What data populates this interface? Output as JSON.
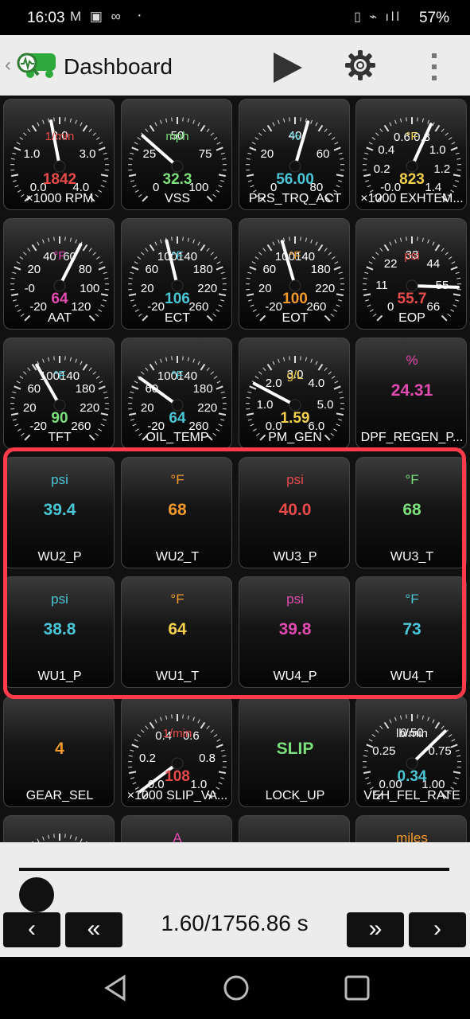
{
  "status": {
    "time": "16:03",
    "left_icons": "M ▣ ∞",
    "more": "·",
    "right_icons": "▯ ⌁ ıll",
    "battery": "57%"
  },
  "appbar": {
    "title": "Dashboard"
  },
  "tiles": [
    {
      "name": "×1000 RPM",
      "unit": "1/min",
      "value": "1842",
      "ticks": [
        "0.0",
        "1.0",
        "2.0",
        "3.0",
        "4.0"
      ],
      "colors": {
        "unit": "#e94b4b",
        "value": "#e94b4b"
      },
      "needle": 0.46
    },
    {
      "name": "VSS",
      "unit": "mph",
      "value": "32.3",
      "ticks": [
        "0",
        "25",
        "50",
        "75",
        "100"
      ],
      "colors": {
        "unit": "#7be07b",
        "value": "#7be07b"
      },
      "needle": 0.32
    },
    {
      "name": "PRS_TRQ_ACT",
      "unit": "%",
      "value": "56.00",
      "ticks": [
        "0",
        "20",
        "40",
        "60",
        "80"
      ],
      "colors": {
        "unit": "#4bc6d6",
        "value": "#4bc6d6"
      },
      "needle": 0.56
    },
    {
      "name": "×1000 EXHTEM...",
      "unit": "°F",
      "value": "823",
      "ticks": [
        "-0.0",
        "0.2",
        "0.4",
        "0.6",
        "0.8",
        "1.0",
        "1.2",
        "1.4"
      ],
      "colors": {
        "unit": "#f2d04b",
        "value": "#f2d04b"
      },
      "needle": 0.59
    },
    {
      "name": "AAT",
      "unit": "°F",
      "value": "64",
      "ticks": [
        "-20",
        "-0",
        "20",
        "40",
        "60",
        "80",
        "100",
        "120"
      ],
      "colors": {
        "unit": "#e14bb0",
        "value": "#e14bb0"
      },
      "needle": 0.6
    },
    {
      "name": "ECT",
      "unit": "°F",
      "value": "106",
      "ticks": [
        "-20",
        "20",
        "60",
        "100",
        "140",
        "180",
        "220",
        "260"
      ],
      "colors": {
        "unit": "#4bc6d6",
        "value": "#4bc6d6"
      },
      "needle": 0.45
    },
    {
      "name": "EOT",
      "unit": "°F",
      "value": "100",
      "ticks": [
        "-20",
        "20",
        "60",
        "100",
        "140",
        "180",
        "220",
        "260"
      ],
      "colors": {
        "unit": "#f39a2b",
        "value": "#f39a2b"
      },
      "needle": 0.44
    },
    {
      "name": "EOP",
      "unit": "psi",
      "value": "55.7",
      "ticks": [
        "0",
        "11",
        "22",
        "33",
        "44",
        "55",
        "66"
      ],
      "colors": {
        "unit": "#e94b4b",
        "value": "#e94b4b"
      },
      "needle": 0.84
    },
    {
      "name": "TFT",
      "unit": "°F",
      "value": "90",
      "ticks": [
        "-20",
        "20",
        "60",
        "100",
        "140",
        "180",
        "220",
        "260"
      ],
      "colors": {
        "unit": "#4bc6d6",
        "value": "#7be07b"
      },
      "needle": 0.39
    },
    {
      "name": "OIL_TEMP",
      "unit": "°F",
      "value": "64",
      "ticks": [
        "-20",
        "20",
        "60",
        "100",
        "140",
        "180",
        "220",
        "260"
      ],
      "colors": {
        "unit": "#4bc6d6",
        "value": "#4bc6d6"
      },
      "needle": 0.3
    },
    {
      "name": "PM_GEN",
      "unit": "g/L",
      "value": "1.59",
      "ticks": [
        "0.0",
        "1.0",
        "2.0",
        "3.0",
        "4.0",
        "5.0",
        "6.0"
      ],
      "colors": {
        "unit": "#f2d04b",
        "value": "#f2d04b"
      },
      "needle": 0.27
    },
    {
      "name": "DPF_REGEN_P...",
      "unit": "%",
      "value": "24.31",
      "colors": {
        "unit": "#e14bb0",
        "value": "#e14bb0"
      }
    },
    {
      "name": "WU2_P",
      "unit": "psi",
      "value": "39.4",
      "colors": {
        "unit": "#4bc6d6",
        "value": "#4bc6d6"
      }
    },
    {
      "name": "WU2_T",
      "unit": "°F",
      "value": "68",
      "colors": {
        "unit": "#f39a2b",
        "value": "#f39a2b"
      }
    },
    {
      "name": "WU3_P",
      "unit": "psi",
      "value": "40.0",
      "colors": {
        "unit": "#e94b4b",
        "value": "#e94b4b"
      }
    },
    {
      "name": "WU3_T",
      "unit": "°F",
      "value": "68",
      "colors": {
        "unit": "#7be07b",
        "value": "#7be07b"
      }
    },
    {
      "name": "WU1_P",
      "unit": "psi",
      "value": "38.8",
      "colors": {
        "unit": "#4bc6d6",
        "value": "#4bc6d6"
      }
    },
    {
      "name": "WU1_T",
      "unit": "°F",
      "value": "64",
      "colors": {
        "unit": "#f39a2b",
        "value": "#f2d04b"
      }
    },
    {
      "name": "WU4_P",
      "unit": "psi",
      "value": "39.8",
      "colors": {
        "unit": "#e14bb0",
        "value": "#e14bb0"
      }
    },
    {
      "name": "WU4_T",
      "unit": "°F",
      "value": "73",
      "colors": {
        "unit": "#4bc6d6",
        "value": "#4bc6d6"
      }
    },
    {
      "name": "GEAR_SEL",
      "unit": "",
      "value": "4",
      "colors": {
        "unit": "#f39a2b",
        "value": "#f39a2b"
      }
    },
    {
      "name": "×1000 SLIP_VA...",
      "unit": "1/min",
      "value": "108",
      "ticks": [
        "0.0",
        "0.2",
        "0.4",
        "0.6",
        "0.8",
        "1.0"
      ],
      "colors": {
        "unit": "#e94b4b",
        "value": "#e94b4b"
      },
      "needle": 0.03
    },
    {
      "name": "LOCK_UP",
      "unit": "",
      "value": "SLIP",
      "colors": {
        "unit": "#7be07b",
        "value": "#7be07b"
      }
    },
    {
      "name": "VEH_FEL_RATE",
      "unit": "lb/min",
      "value": "0.34",
      "ticks": [
        "0.00",
        "0.25",
        "0.50",
        "0.75",
        "1.00"
      ],
      "colors": {
        "unit": "#fff",
        "value": "#4bc6d6"
      },
      "needle": 0.67
    },
    {
      "name": "",
      "unit": "",
      "value": "",
      "ticks": [
        "12.0"
      ],
      "colors": {
        "unit": "#fff",
        "value": "#fff"
      },
      "partial": true
    },
    {
      "name": "",
      "unit": "A",
      "value": "",
      "colors": {
        "unit": "#e14bb0",
        "value": "#e14bb0"
      },
      "partial": true
    },
    {
      "name": "",
      "unit": "",
      "value": "",
      "colors": {
        "unit": "#fff",
        "value": "#fff"
      },
      "partial": true
    },
    {
      "name": "",
      "unit": "miles",
      "value": "",
      "colors": {
        "unit": "#f39a2b",
        "value": "#f39a2b"
      },
      "partial": true
    }
  ],
  "player": {
    "time_readout": "1.60/1756.86 s",
    "buttons": {
      "prev": "‹",
      "rewind": "«",
      "forward": "»",
      "next": "›"
    }
  }
}
